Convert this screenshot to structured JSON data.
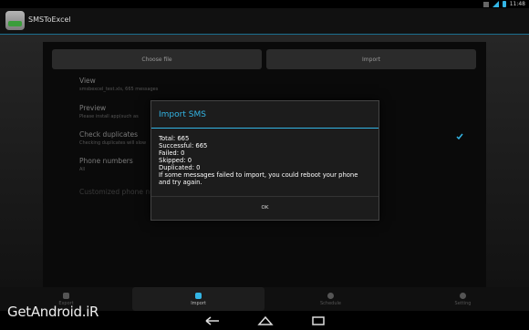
{
  "status": {
    "time": "11:48"
  },
  "app": {
    "title": "SMSToExcel"
  },
  "toolbar": {
    "choose_file": "Choose file",
    "import": "Import"
  },
  "settings": [
    {
      "title": "View",
      "subtitle": "smsbexcel_test.xls, 665 messages"
    },
    {
      "title": "Preview",
      "subtitle": "Please install app(such as"
    },
    {
      "title": "Check duplicates",
      "subtitle": "Checking duplicates will slow",
      "checked": true
    },
    {
      "title": "Phone numbers",
      "subtitle": "All"
    },
    {
      "title": "Customized phone nu",
      "subtitle": ""
    }
  ],
  "dialog": {
    "title": "Import SMS",
    "lines": [
      "Total: 665",
      "Successful: 665",
      "Failed: 0",
      "Skipped: 0",
      "Duplicated: 0"
    ],
    "message": "If some messages failed to import, you could reboot your phone and try again.",
    "ok": "OK"
  },
  "tabs": [
    {
      "label": "Export",
      "icon": "export-icon",
      "selected": false
    },
    {
      "label": "Import",
      "icon": "import-icon",
      "selected": true
    },
    {
      "label": "Schedule",
      "icon": "schedule-icon",
      "selected": false
    },
    {
      "label": "Setting",
      "icon": "setting-icon",
      "selected": false
    }
  ],
  "watermark": "GetAndroid.iR",
  "colors": {
    "accent": "#33b5e5",
    "background": "#000000",
    "dialog": "#1c1c1c"
  }
}
